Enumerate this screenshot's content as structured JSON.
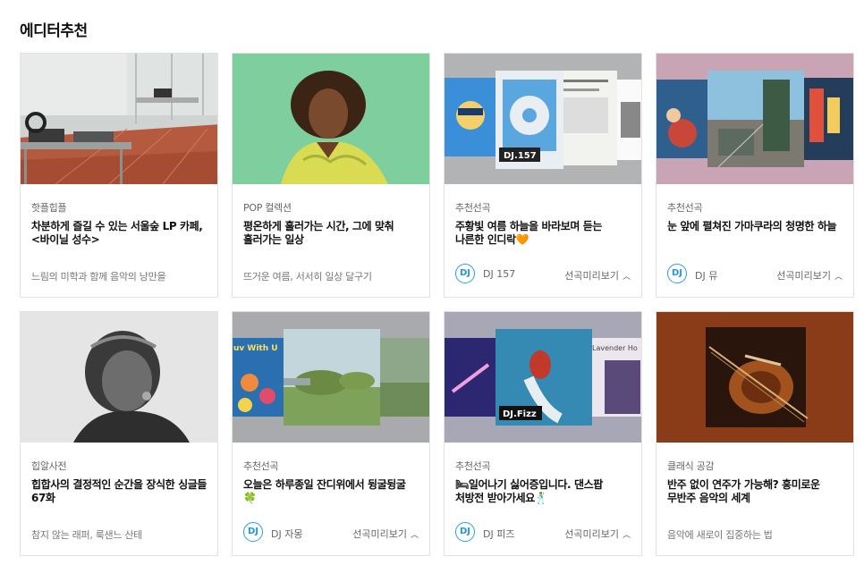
{
  "section": {
    "title": "에디터추천"
  },
  "cards": [
    {
      "category": "핫플힙플",
      "title": "차분하게 즐길 수 있는 서울숲 LP 카페, <바이닐 성수>",
      "desc": "느림의 미학과 함께 음악의 낭만을"
    },
    {
      "category": "POP 컬렉션",
      "title": "평온하게 흘러가는 시간, 그에 맞춰 흘러가는 일상",
      "desc": "뜨거운 여름, 서서히 일상 달구기"
    },
    {
      "category": "추천선곡",
      "title": "주황빛 여름 하늘을 바라보며 듣는 나른한 인디락🧡",
      "badge": "DJ",
      "dj_name": "DJ 157",
      "preview_label": "선곡미리보기",
      "thumb_caption": "DJ.157"
    },
    {
      "category": "추천선곡",
      "title": "눈 앞에 펼쳐진 가마쿠라의 청명한 하늘",
      "badge": "DJ",
      "dj_name": "DJ 뮤",
      "preview_label": "선곡미리보기"
    },
    {
      "category": "힙알사전",
      "title": "힙합사의 결정적인 순간을 장식한 싱글들 67화",
      "desc": "참지 않는 래퍼, 룩샌느 산테"
    },
    {
      "category": "추천선곡",
      "title": "오늘은 하루종일 잔디위에서 뒹굴뒹굴 🍀",
      "badge": "DJ",
      "dj_name": "DJ 자몽",
      "preview_label": "선곡미리보기",
      "thumb_caption": "uv With U"
    },
    {
      "category": "추천선곡",
      "title": "🛏일어나기 싫어증입니다. 댄스팝 처방전 받아가세요🕺",
      "badge": "DJ",
      "dj_name": "DJ 피즈",
      "preview_label": "선곡미리보기",
      "thumb_caption": "DJ.Fizz",
      "thumb_caption2": "Lavender Ho"
    },
    {
      "category": "클래식 공감",
      "title": "반주 없이 연주가 가능해? 흥미로운 무반주 음악의 세계",
      "desc": "음악에 새로이 집중하는 법"
    }
  ]
}
